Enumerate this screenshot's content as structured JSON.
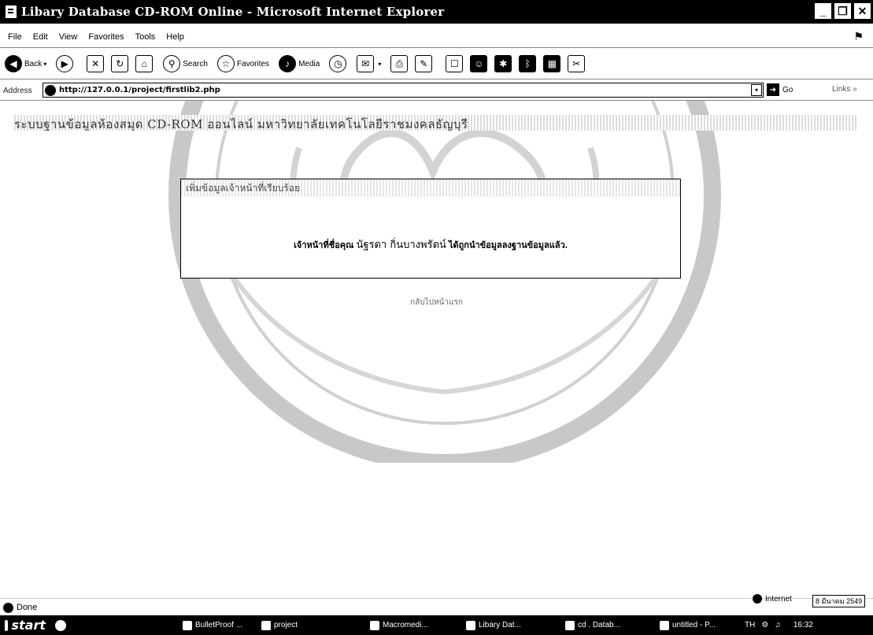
{
  "window": {
    "title": "Libary Database CD-ROM Online - Microsoft Internet Explorer"
  },
  "menu": [
    "File",
    "Edit",
    "View",
    "Favorites",
    "Tools",
    "Help"
  ],
  "toolbar": {
    "back": "Back",
    "search": "Search",
    "favorites": "Favorites",
    "media": "Media"
  },
  "address": {
    "label": "Address",
    "url": "http://127.0.0.1/project/firstlib2.php",
    "go": "Go",
    "links": "Links"
  },
  "page": {
    "heading": "ระบบฐานข้อมูลห้องสมุด CD-ROM ออนไลน์ มหาวิทยาลัยเทคโนโลยีราชมงคลธัญบุรี",
    "box_title": "เพิ่มข้อมูลเจ้าหน้าที่เรียบร้อย",
    "message_prefix": "เจ้าหน้าที่ชื่อคุณ",
    "message_name": "นัฐรดา กิ่นบางพรัตน์",
    "message_suffix": "ได้ถูกนำข้อมูลลงฐานข้อมูลแล้ว.",
    "back_link": "กลับไปหน้าแรก"
  },
  "status": {
    "text": "Done",
    "zone": "Internet",
    "date": "8 มีนาคม 2549"
  },
  "taskbar": {
    "start": "start",
    "tasks": [
      "BulletProof ...",
      "project",
      "Macromedi...",
      "Libary Dat...",
      "cd . Datab...",
      "untitled - P..."
    ],
    "lang": "TH",
    "clock": "16:32"
  }
}
